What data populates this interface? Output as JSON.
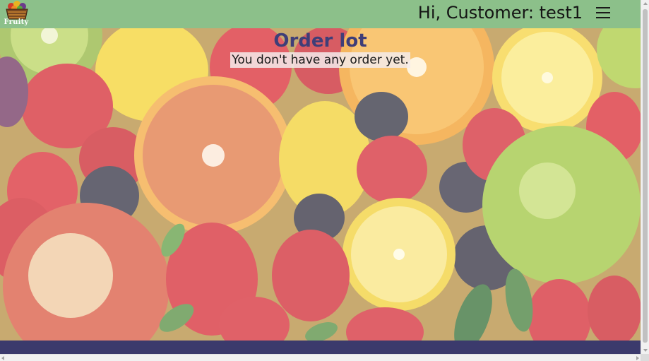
{
  "header": {
    "logo_text": "Fruity",
    "greeting": "Hi, Customer: test1",
    "menu_icon": "hamburger-menu-icon"
  },
  "main": {
    "title": "Order lot",
    "empty_message": "You don't have any order yet."
  },
  "colors": {
    "header_bg": "#8cc08a",
    "title": "#3f3e78",
    "footer_bg": "#3b3a6c"
  }
}
